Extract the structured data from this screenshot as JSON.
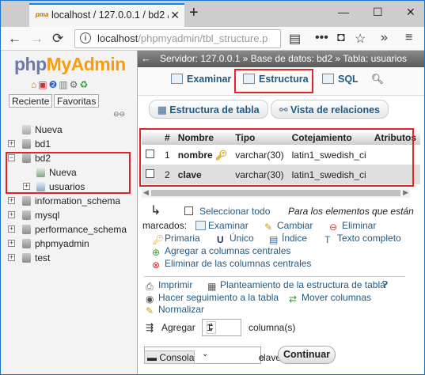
{
  "browser": {
    "tab_title": "localhost / 127.0.0.1 / bd2 / us",
    "tab_close": "✕",
    "new_tab": "+",
    "url_host": "localhost",
    "url_path": "/phpmyadmin/tbl_structure.p",
    "window_controls": [
      "—",
      "☐",
      "✕"
    ]
  },
  "sidebar": {
    "logo_php": "php",
    "logo_my": "MyAdmin",
    "buttons": [
      "Reciente",
      "Favoritas"
    ],
    "tree": [
      {
        "label": "Nueva",
        "level": 1
      },
      {
        "label": "bd1",
        "level": 0
      },
      {
        "label": "bd2",
        "level": 0
      },
      {
        "label": "Nueva",
        "level": 2
      },
      {
        "label": "usuarios",
        "level": 2
      },
      {
        "label": "information_schema",
        "level": 0
      },
      {
        "label": "mysql",
        "level": 0
      },
      {
        "label": "performance_schema",
        "level": 0
      },
      {
        "label": "phpmyadmin",
        "level": 0
      },
      {
        "label": "test",
        "level": 0
      }
    ]
  },
  "main": {
    "breadcrumb": "Servidor: 127.0.0.1 » Base de datos: bd2 » Tabla: usuarios",
    "tabs": [
      "Examinar",
      "Estructura",
      "SQL"
    ],
    "subtabs": [
      "Estructura de tabla",
      "Vista de relaciones"
    ],
    "table": {
      "headers": [
        "",
        "#",
        "Nombre",
        "Tipo",
        "Cotejamiento",
        "Atributos"
      ],
      "rows": [
        {
          "num": "1",
          "name": "nombre",
          "type": "varchar(30)",
          "collation": "latin1_swedish_ci"
        },
        {
          "num": "2",
          "name": "clave",
          "type": "varchar(30)",
          "collation": "latin1_swedish_ci"
        }
      ]
    },
    "select_all": "Seleccionar todo",
    "for_marked": "Para los elementos que están",
    "marked_label": "marcados:",
    "marked_actions": [
      "Examinar",
      "Cambiar",
      "Eliminar",
      "Primaria",
      "Único",
      "Índice",
      "Texto completo",
      "Agregar a columnas centrales",
      "Eliminar de las columnas centrales"
    ],
    "bottom_links": [
      "Imprimir",
      "Planteamiento de la estructura de tabla",
      "Hacer seguimiento a la tabla",
      "Mover columnas",
      "Normalizar"
    ],
    "add_label": "Agregar",
    "add_count": "1",
    "columns_label": "columna(s)",
    "position_value": "clave",
    "after_prefix": "e",
    "go_button": "Continuar",
    "console": "Consola"
  }
}
